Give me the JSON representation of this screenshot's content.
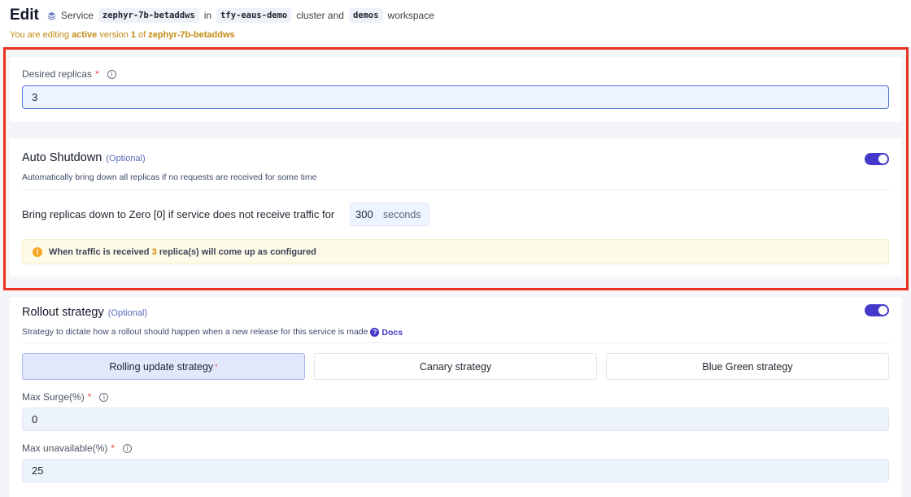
{
  "header": {
    "title": "Edit",
    "service_label": "Service",
    "service_name": "zephyr-7b-betaddws",
    "in_label": "in",
    "cluster_name": "tfy-eaus-demo",
    "cluster_label": "cluster and",
    "workspace_name": "demos",
    "workspace_label": "workspace",
    "notice_prefix": "You are editing",
    "notice_active": "active",
    "notice_version_label": "version",
    "notice_version": "1",
    "notice_of": "of",
    "notice_name": "zephyr-7b-betaddws"
  },
  "replicas": {
    "label": "Desired replicas",
    "required_mark": "*",
    "value": "3"
  },
  "auto_shutdown": {
    "title": "Auto Shutdown",
    "optional": "(Optional)",
    "description": "Automatically bring down all replicas if no requests are received for some time",
    "enabled": true,
    "wait_label": "Bring replicas down to Zero [0] if service does not receive traffic for",
    "wait_value": "300",
    "wait_unit": "seconds",
    "warning_prefix": "When traffic is received",
    "warning_count": "3",
    "warning_suffix": "replica(s) will come up as configured"
  },
  "rollout": {
    "title": "Rollout strategy",
    "optional": "(Optional)",
    "description": "Strategy to dictate how a rollout should happen when a new release for this service is made",
    "docs_label": "Docs",
    "enabled": true,
    "strategies": [
      {
        "label": "Rolling update strategy",
        "selected": true,
        "required_mark": "*"
      },
      {
        "label": "Canary strategy",
        "selected": false
      },
      {
        "label": "Blue Green strategy",
        "selected": false
      }
    ],
    "max_surge": {
      "label": "Max Surge(%)",
      "required_mark": "*",
      "value": "0"
    },
    "max_unavailable": {
      "label": "Max unavailable(%)",
      "required_mark": "*",
      "value": "25"
    }
  },
  "colors": {
    "accent": "#4338ca",
    "highlight_border": "#e8321f",
    "notice": "#c28a0e",
    "warning_bg": "#fefbe8"
  }
}
